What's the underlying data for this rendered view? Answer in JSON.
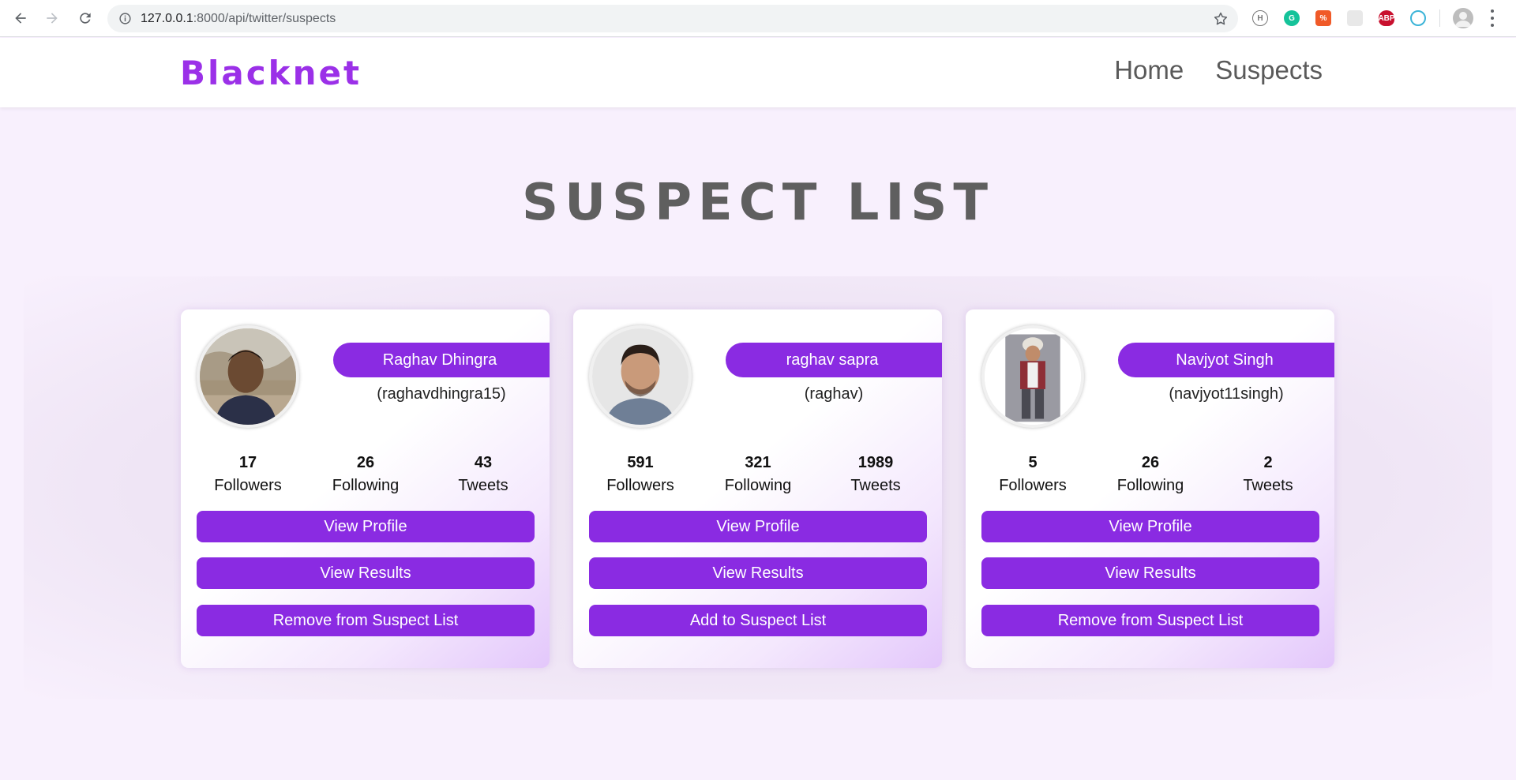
{
  "browser": {
    "url_host": "127.0.0.1",
    "url_rest": ":8000/api/twitter/suspects",
    "icons": [
      "back-icon",
      "forward-icon",
      "reload-icon",
      "info-icon",
      "star-icon"
    ]
  },
  "header": {
    "brand": "Blacknet",
    "nav": [
      {
        "label": "Home"
      },
      {
        "label": "Suspects"
      }
    ]
  },
  "page": {
    "title": "SUSPECT LIST"
  },
  "colors": {
    "accent": "#8a2be2",
    "brand": "#9b30e8",
    "background": "#f8f0fd"
  },
  "suspects": [
    {
      "name": "Raghav Dhingra",
      "handle": "(raghavdhingra15)",
      "followers": "17",
      "following": "26",
      "tweets": "43",
      "labels": {
        "followers": "Followers",
        "following": "Following",
        "tweets": "Tweets"
      },
      "buttons": {
        "profile": "View Profile",
        "results": "View Results",
        "list": "Remove from Suspect List"
      }
    },
    {
      "name": "raghav sapra",
      "handle": "(raghav)",
      "followers": "591",
      "following": "321",
      "tweets": "1989",
      "labels": {
        "followers": "Followers",
        "following": "Following",
        "tweets": "Tweets"
      },
      "buttons": {
        "profile": "View Profile",
        "results": "View Results",
        "list": "Add to Suspect List"
      }
    },
    {
      "name": "Navjyot Singh",
      "handle": "(navjyot11singh)",
      "followers": "5",
      "following": "26",
      "tweets": "2",
      "labels": {
        "followers": "Followers",
        "following": "Following",
        "tweets": "Tweets"
      },
      "buttons": {
        "profile": "View Profile",
        "results": "View Results",
        "list": "Remove from Suspect List"
      }
    }
  ]
}
